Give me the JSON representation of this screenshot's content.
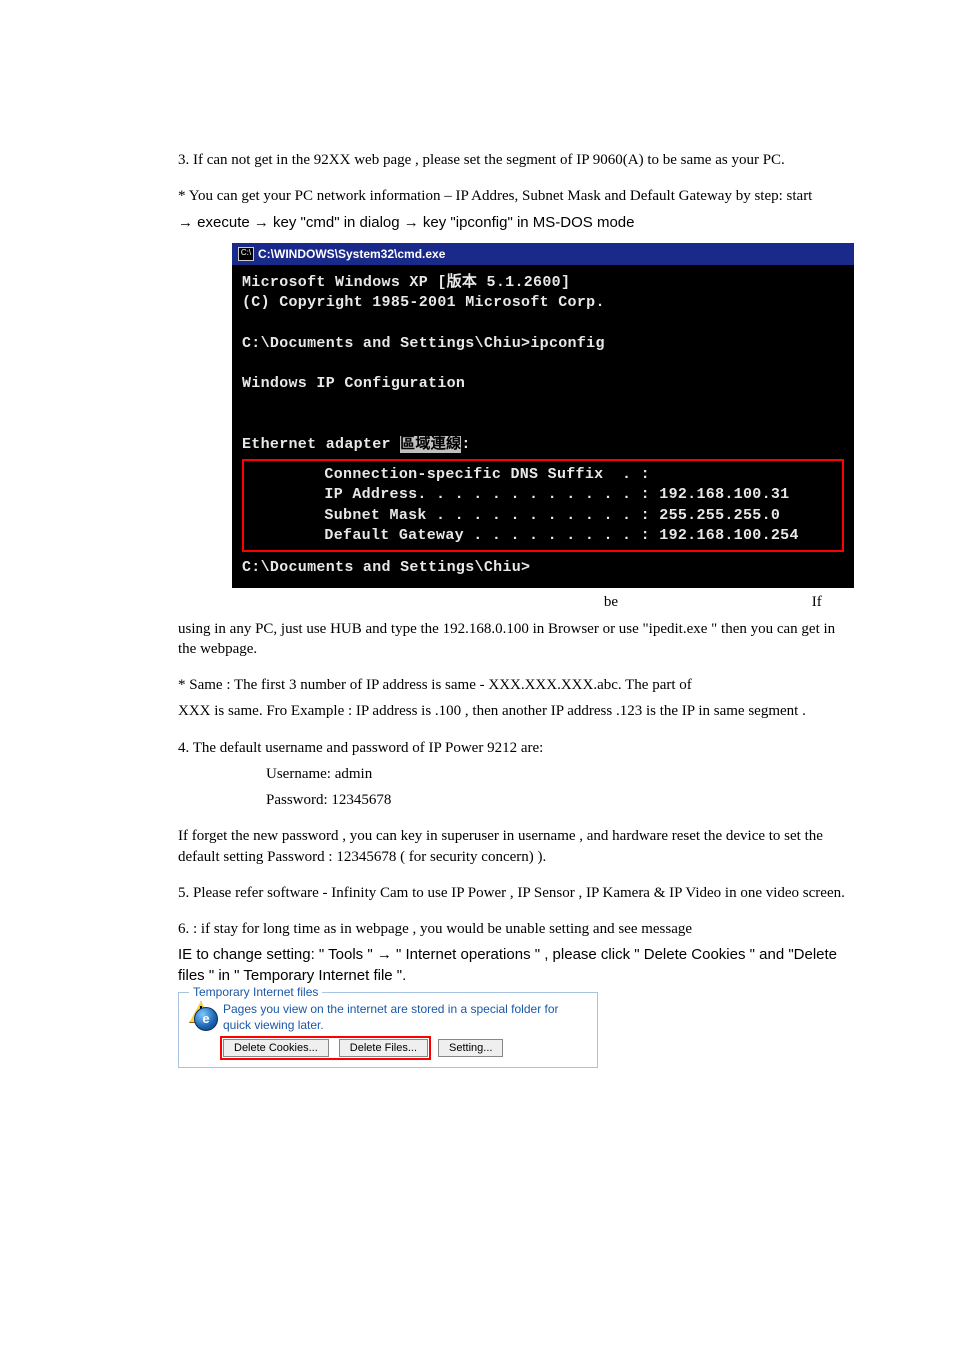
{
  "para1": "3.  If can not get in the 92XX web page , please set the segment of IP 9060(A) to be same as your PC.",
  "para2a": "* You can get your PC network information – IP Addres, Subnet Mask and Default Gateway by  step: start",
  "para2b_prefix": "→ execute → key \"cmd\" in dialog →    key  \"ipconfig\" in MS-DOS mode",
  "console": {
    "title": " C:\\WINDOWS\\System32\\cmd.exe",
    "icon_text": "C:\\",
    "line1": "Microsoft Windows XP [版本 5.1.2600]",
    "line2": "(C) Copyright 1985-2001 Microsoft Corp.",
    "line3": "C:\\Documents and Settings\\Chiu>ipconfig",
    "line4": "Windows IP Configuration",
    "line5a": "Ethernet adapter ",
    "line5b": "區域連線",
    "line5c": ":",
    "box1": "        Connection-specific DNS Suffix  . :",
    "box2": "        IP Address. . . . . . . . . . . . : 192.168.100.31",
    "box3": "        Subnet Mask . . . . . . . . . . . : 255.255.255.0",
    "box4": "        Default Gateway . . . . . . . . . : 192.168.100.254",
    "line6": "C:\\Documents and Settings\\Chiu>"
  },
  "be": "be",
  "if": "If",
  "para3b": "using in any PC, just use HUB and type the 192.168.0.100 in Browser or use \"ipedit.exe \" then you can get in the webpage.",
  "para4a": "* Same                           :  The first  3 number of  IP address is same -  XXX.XXX.XXX.abc.  The part of",
  "para4b": "XXX is same. Fro Example : IP address is                    .100 , then another IP address                   .123 is the IP in same segment .",
  "para5a": "4. The default username and password of IP Power 9212 are:",
  "para5b": "Username: admin",
  "para5c": "Password:  12345678",
  "para6": "If forget the new password ,  you can key in  superuser  in username ,  and  hardware reset the  device to set the default setting  Password :    12345678      ( for security concern) ).",
  "para7": "5.  Please refer software  - Infinity Cam  to use  IP Power , IP Sensor ,  IP Kamera & IP Video  in one video screen.",
  "para8a": "6.           : if stay for long time as in webpage , you would be unable setting and see  message",
  "para8b": "                             IE to change setting:  \" Tools \" → \" Internet operations \"  , please click   \" Delete Cookies \" and \"Delete files \" in   \" Temporary Internet file  \".",
  "tempfiles": {
    "legend": "Temporary Internet files",
    "desc": "Pages you view on the internet are stored in a special folder for quick viewing later.",
    "btn_cookies": "Delete Cookies...",
    "btn_files": "Delete Files...",
    "btn_setting": "Setting..."
  }
}
